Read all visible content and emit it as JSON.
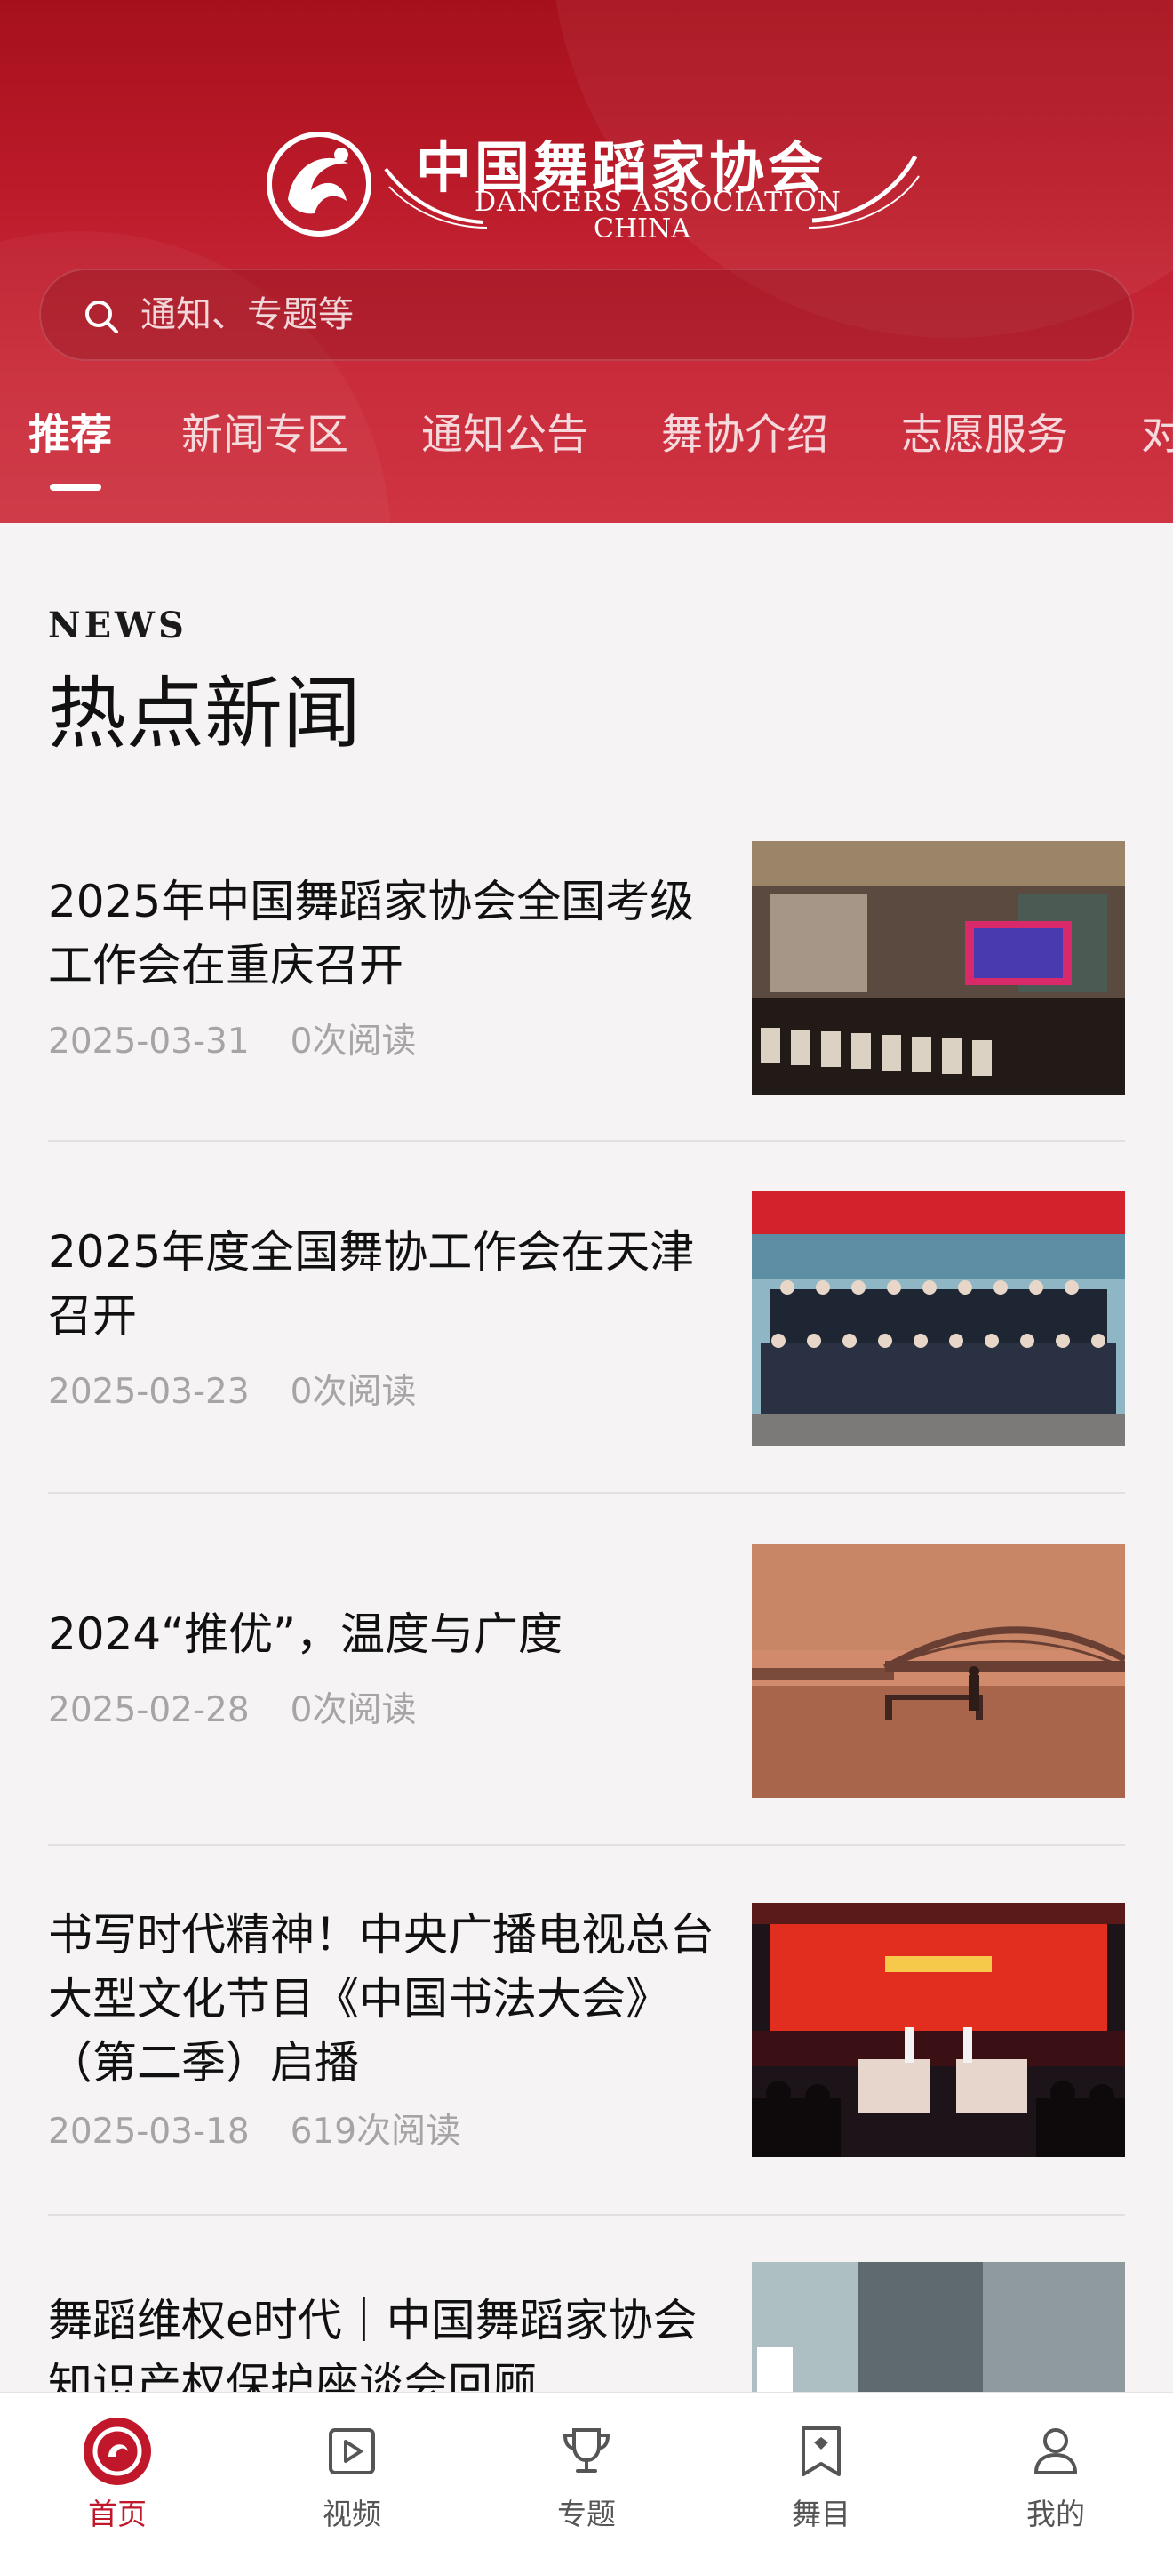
{
  "header": {
    "logo": {
      "name_cn": "中国舞蹈家协会",
      "name_en_line1": "DANCERS ASSOCIATION",
      "name_en_line2": "CHINA"
    },
    "search": {
      "placeholder": "通知、专题等",
      "value": ""
    },
    "tabs": [
      {
        "label": "推荐",
        "active": true
      },
      {
        "label": "新闻专区",
        "active": false
      },
      {
        "label": "通知公告",
        "active": false
      },
      {
        "label": "舞协介绍",
        "active": false
      },
      {
        "label": "志愿服务",
        "active": false
      },
      {
        "label": "对",
        "active": false
      }
    ]
  },
  "section": {
    "label_en": "NEWS",
    "title": "热点新闻"
  },
  "news": [
    {
      "title": "2025年中国舞蹈家协会全国考级工作会在重庆召开",
      "date": "2025-03-31",
      "views": "0次阅读"
    },
    {
      "title": "2025年度全国舞协工作会在天津召开",
      "date": "2025-03-23",
      "views": "0次阅读"
    },
    {
      "title": "2024“推优”，温度与广度",
      "date": "2025-02-28",
      "views": "0次阅读"
    },
    {
      "title": "书写时代精神！中央广播电视总台大型文化节目《中国书法大会》（第二季）启播",
      "date": "2025-03-18",
      "views": "619次阅读"
    },
    {
      "title": "舞蹈维权e时代｜中国舞蹈家协会知识产权保护座谈会回顾",
      "date": "",
      "views": ""
    }
  ],
  "bottom_nav": [
    {
      "label": "首页",
      "icon": "home-icon",
      "active": true
    },
    {
      "label": "视频",
      "icon": "video-icon",
      "active": false
    },
    {
      "label": "专题",
      "icon": "trophy-icon",
      "active": false
    },
    {
      "label": "舞目",
      "icon": "bookmark-icon",
      "active": false
    },
    {
      "label": "我的",
      "icon": "profile-icon",
      "active": false
    }
  ],
  "colors": {
    "brand_red": "#c0182a",
    "header_top": "#a6101c",
    "header_bottom": "#cf3442",
    "meta_gray": "#a7a4a5",
    "page_bg": "#f5f3f4"
  }
}
